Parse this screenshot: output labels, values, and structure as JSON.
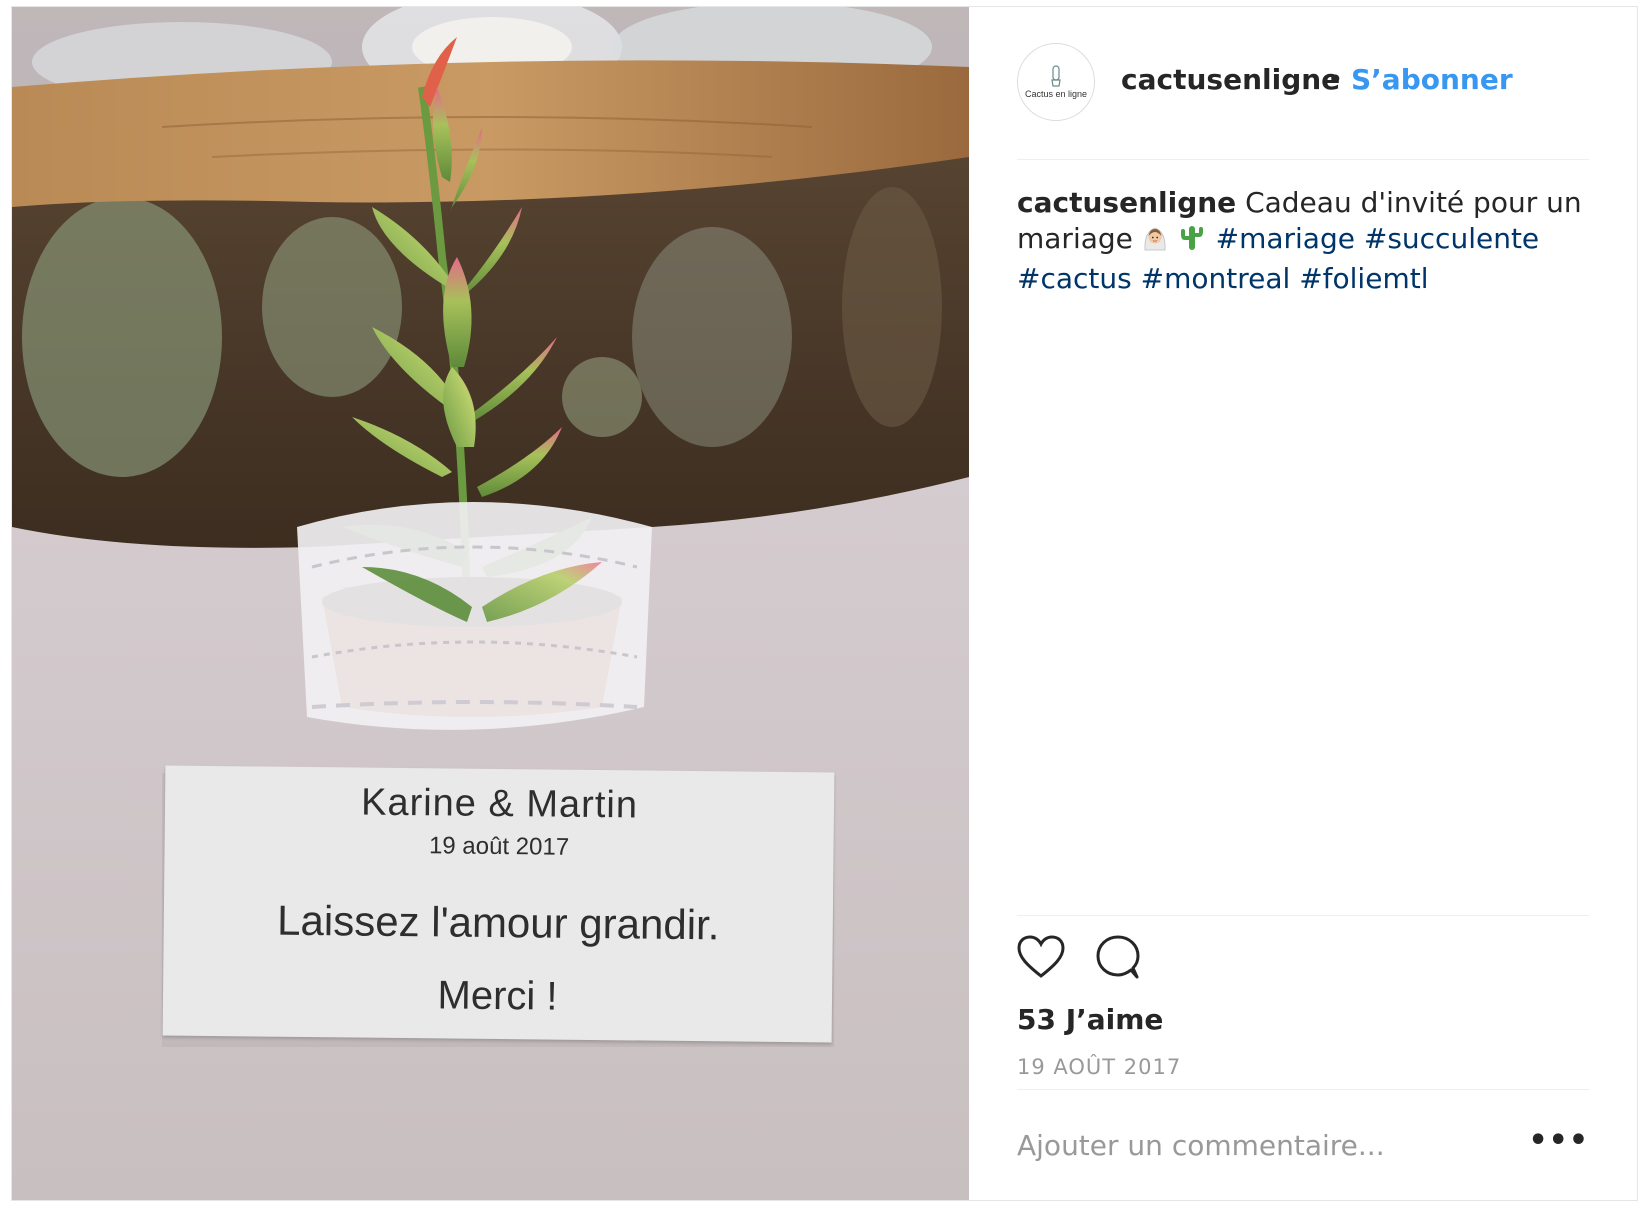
{
  "post": {
    "username": "cactusenligne",
    "separator": "•",
    "follow_label": "S’abonner",
    "avatar_text": "Cactus en ligne",
    "caption": {
      "user": "cactusenligne",
      "text_line1": "Cadeau d'invité pour un",
      "text_line2": "mariage",
      "emojis": [
        "bride-emoji",
        "cactus-emoji"
      ],
      "hashtags_line2": [
        "#mariage",
        "#succulente"
      ],
      "hashtags_line3": [
        "#cactus",
        "#montreal",
        "#foliemtl"
      ]
    },
    "likes": "53 J’aime",
    "date": "19 AOÛT 2017",
    "comment_placeholder": "Ajouter un commentaire...",
    "more_label": "•••",
    "icons": [
      "heart-icon",
      "comment-icon",
      "more-options-icon"
    ]
  },
  "photo": {
    "card": {
      "names": "Karine & Martin",
      "date": "19 août 2017",
      "message": "Laissez l'amour grandir.",
      "thanks": "Merci !"
    }
  },
  "colors": {
    "link": "#3897f0",
    "hashtag": "#003569",
    "text": "#262626",
    "muted": "#999999",
    "border": "#efefef"
  }
}
